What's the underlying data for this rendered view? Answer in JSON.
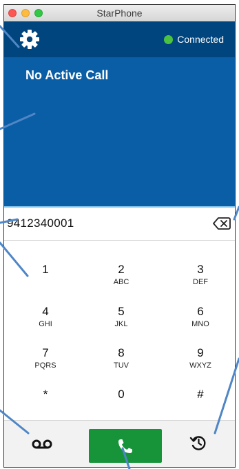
{
  "window": {
    "title": "StarPhone"
  },
  "header": {
    "status_label": "Connected",
    "status_color": "#4bc341",
    "settings_icon": "gear-icon"
  },
  "call_panel": {
    "title": "No Active Call"
  },
  "dialer": {
    "number": "9412340001",
    "backspace_icon": "backspace-icon"
  },
  "keypad": {
    "keys": [
      {
        "digit": "1",
        "letters": ""
      },
      {
        "digit": "2",
        "letters": "ABC"
      },
      {
        "digit": "3",
        "letters": "DEF"
      },
      {
        "digit": "4",
        "letters": "GHI"
      },
      {
        "digit": "5",
        "letters": "JKL"
      },
      {
        "digit": "6",
        "letters": "MNO"
      },
      {
        "digit": "7",
        "letters": "PQRS"
      },
      {
        "digit": "8",
        "letters": "TUV"
      },
      {
        "digit": "9",
        "letters": "WXYZ"
      },
      {
        "digit": "*",
        "letters": ""
      },
      {
        "digit": "0",
        "letters": ""
      },
      {
        "digit": "#",
        "letters": ""
      }
    ]
  },
  "bottom_bar": {
    "voicemail_icon": "voicemail-icon",
    "call_icon": "phone-icon",
    "call_color": "#17943a",
    "history_icon": "history-icon"
  },
  "colors": {
    "header": "#01457e",
    "call_panel": "#0a5ea5",
    "callout": "#4f86c6"
  }
}
